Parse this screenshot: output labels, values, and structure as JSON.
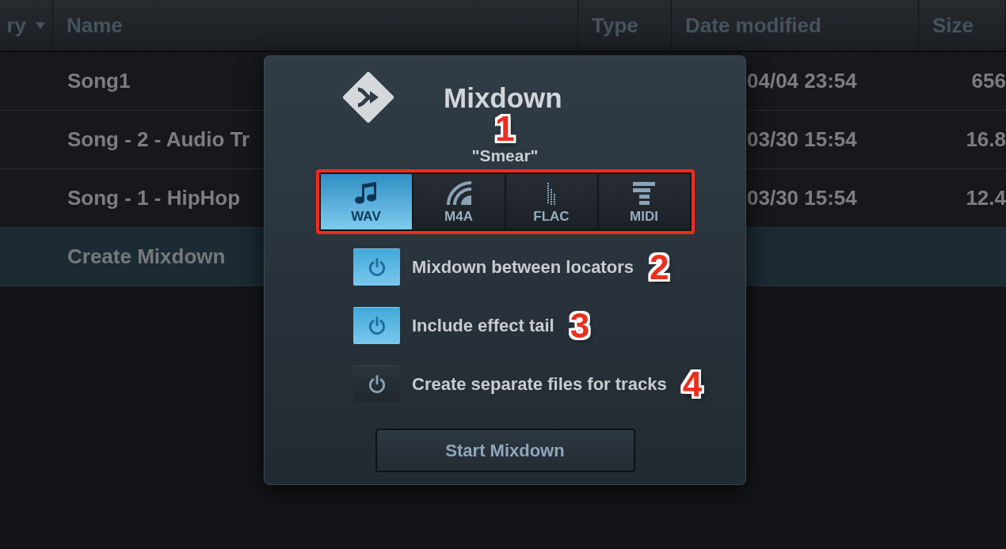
{
  "file_list": {
    "columns": [
      {
        "label": "ry",
        "caret": true
      },
      {
        "label": "Name"
      },
      {
        "label": "Type"
      },
      {
        "label": "Date modified"
      },
      {
        "label": "Size"
      }
    ],
    "rows": [
      {
        "name": "Song1",
        "date": "04/04 23:54",
        "size": "656",
        "selected": false
      },
      {
        "name": "Song - 2 - Audio Tr",
        "date": "03/30 15:54",
        "size": "16.8",
        "selected": false
      },
      {
        "name": "Song - 1 - HipHop",
        "date": "03/30 15:54",
        "size": "12.4",
        "selected": false
      },
      {
        "name": "Create Mixdown",
        "selected": true
      }
    ]
  },
  "dialog": {
    "title": "Mixdown",
    "subtitle": "\"Smear\"",
    "format_callout": "1",
    "formats": [
      {
        "kind": "note",
        "label": "WAV",
        "selected": true
      },
      {
        "kind": "arcs",
        "label": "M4A",
        "selected": false
      },
      {
        "kind": "meter",
        "label": "FLAC",
        "selected": false
      },
      {
        "kind": "bars",
        "label": "MIDI",
        "selected": false
      }
    ],
    "options": [
      {
        "label": "Mixdown between locators",
        "on": true,
        "callout": "2"
      },
      {
        "label": "Include effect tail",
        "on": true,
        "callout": "3"
      },
      {
        "label": "Create separate files for tracks",
        "on": false,
        "callout": "4"
      }
    ],
    "button": "Start Mixdown"
  }
}
